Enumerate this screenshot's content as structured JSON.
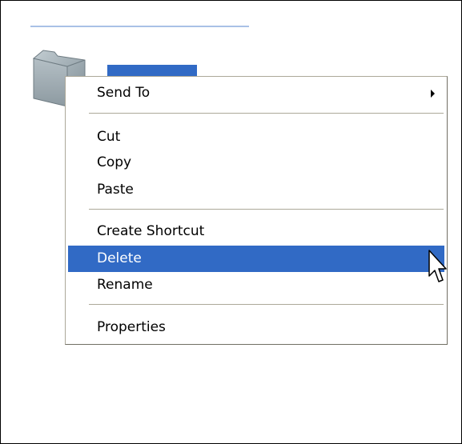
{
  "context_menu": {
    "items": [
      {
        "label": "Send To",
        "has_submenu": true
      },
      {
        "label": "Cut"
      },
      {
        "label": "Copy"
      },
      {
        "label": "Paste"
      },
      {
        "label": "Create Shortcut"
      },
      {
        "label": "Delete",
        "highlighted": true
      },
      {
        "label": "Rename"
      },
      {
        "label": "Properties"
      }
    ]
  },
  "icons": {
    "folder": "folder-icon",
    "submenu": "triangle-right-icon",
    "cursor": "arrow-cursor-icon"
  },
  "colors": {
    "selection": "#316ac5",
    "menu_border": "#aca899",
    "folder": "#9aa7ae",
    "rule": "#a9c1e6"
  }
}
